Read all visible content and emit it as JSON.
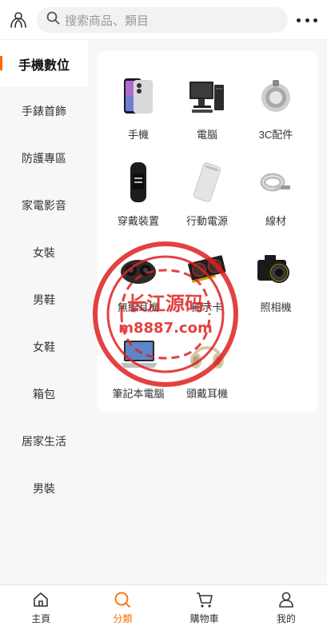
{
  "header": {
    "search_placeholder": "搜索商品、類目"
  },
  "sidebar": {
    "items": [
      {
        "label": "手機數位",
        "active": true
      },
      {
        "label": "手錶首飾"
      },
      {
        "label": "防護專區"
      },
      {
        "label": "家電影音"
      },
      {
        "label": "女裝"
      },
      {
        "label": "男鞋"
      },
      {
        "label": "女鞋"
      },
      {
        "label": "箱包"
      },
      {
        "label": "居家生活"
      },
      {
        "label": "男裝"
      }
    ]
  },
  "categories": [
    {
      "label": "手機",
      "icon": "smartphone-icon"
    },
    {
      "label": "電腦",
      "icon": "desktop-computer-icon"
    },
    {
      "label": "3C配件",
      "icon": "speaker-accessory-icon"
    },
    {
      "label": "穿戴裝置",
      "icon": "fitness-band-icon"
    },
    {
      "label": "行動電源",
      "icon": "power-bank-icon"
    },
    {
      "label": "線材",
      "icon": "cable-icon"
    },
    {
      "label": "無線耳機",
      "icon": "wireless-earbuds-icon"
    },
    {
      "label": "顯示卡",
      "icon": "graphics-card-icon"
    },
    {
      "label": "照相機",
      "icon": "camera-icon"
    },
    {
      "label": "筆記本電腦",
      "icon": "laptop-icon"
    },
    {
      "label": "頭戴耳機",
      "icon": "headphones-icon"
    }
  ],
  "watermark": {
    "line1": "长江源码",
    "line2": "m8887.com",
    "color": "#e02020"
  },
  "tabbar": {
    "tabs": [
      {
        "label": "主頁",
        "icon": "home-icon"
      },
      {
        "label": "分類",
        "icon": "search-icon",
        "active": true
      },
      {
        "label": "購物車",
        "icon": "cart-icon"
      },
      {
        "label": "我的",
        "icon": "user-icon"
      }
    ]
  },
  "colors": {
    "accent": "#ff6a00",
    "sidebar_bg": "#f7f7f7"
  }
}
